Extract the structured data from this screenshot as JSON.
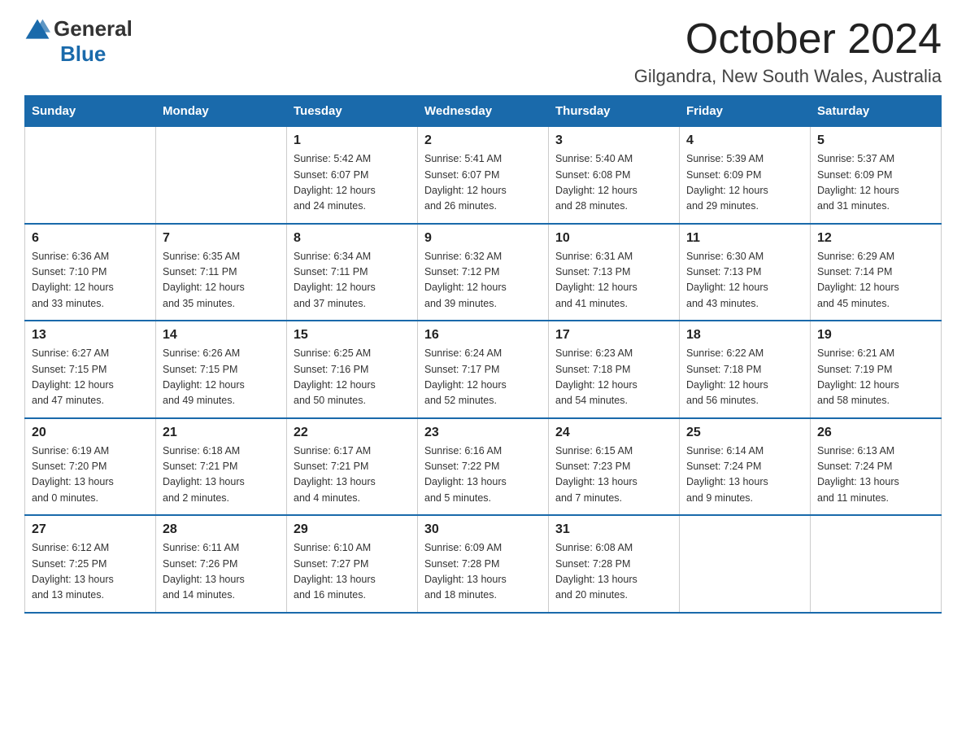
{
  "header": {
    "logo_general": "General",
    "logo_blue": "Blue",
    "month_year": "October 2024",
    "location": "Gilgandra, New South Wales, Australia"
  },
  "calendar": {
    "days_of_week": [
      "Sunday",
      "Monday",
      "Tuesday",
      "Wednesday",
      "Thursday",
      "Friday",
      "Saturday"
    ],
    "weeks": [
      [
        {
          "day": "",
          "info": ""
        },
        {
          "day": "",
          "info": ""
        },
        {
          "day": "1",
          "info": "Sunrise: 5:42 AM\nSunset: 6:07 PM\nDaylight: 12 hours\nand 24 minutes."
        },
        {
          "day": "2",
          "info": "Sunrise: 5:41 AM\nSunset: 6:07 PM\nDaylight: 12 hours\nand 26 minutes."
        },
        {
          "day": "3",
          "info": "Sunrise: 5:40 AM\nSunset: 6:08 PM\nDaylight: 12 hours\nand 28 minutes."
        },
        {
          "day": "4",
          "info": "Sunrise: 5:39 AM\nSunset: 6:09 PM\nDaylight: 12 hours\nand 29 minutes."
        },
        {
          "day": "5",
          "info": "Sunrise: 5:37 AM\nSunset: 6:09 PM\nDaylight: 12 hours\nand 31 minutes."
        }
      ],
      [
        {
          "day": "6",
          "info": "Sunrise: 6:36 AM\nSunset: 7:10 PM\nDaylight: 12 hours\nand 33 minutes."
        },
        {
          "day": "7",
          "info": "Sunrise: 6:35 AM\nSunset: 7:11 PM\nDaylight: 12 hours\nand 35 minutes."
        },
        {
          "day": "8",
          "info": "Sunrise: 6:34 AM\nSunset: 7:11 PM\nDaylight: 12 hours\nand 37 minutes."
        },
        {
          "day": "9",
          "info": "Sunrise: 6:32 AM\nSunset: 7:12 PM\nDaylight: 12 hours\nand 39 minutes."
        },
        {
          "day": "10",
          "info": "Sunrise: 6:31 AM\nSunset: 7:13 PM\nDaylight: 12 hours\nand 41 minutes."
        },
        {
          "day": "11",
          "info": "Sunrise: 6:30 AM\nSunset: 7:13 PM\nDaylight: 12 hours\nand 43 minutes."
        },
        {
          "day": "12",
          "info": "Sunrise: 6:29 AM\nSunset: 7:14 PM\nDaylight: 12 hours\nand 45 minutes."
        }
      ],
      [
        {
          "day": "13",
          "info": "Sunrise: 6:27 AM\nSunset: 7:15 PM\nDaylight: 12 hours\nand 47 minutes."
        },
        {
          "day": "14",
          "info": "Sunrise: 6:26 AM\nSunset: 7:15 PM\nDaylight: 12 hours\nand 49 minutes."
        },
        {
          "day": "15",
          "info": "Sunrise: 6:25 AM\nSunset: 7:16 PM\nDaylight: 12 hours\nand 50 minutes."
        },
        {
          "day": "16",
          "info": "Sunrise: 6:24 AM\nSunset: 7:17 PM\nDaylight: 12 hours\nand 52 minutes."
        },
        {
          "day": "17",
          "info": "Sunrise: 6:23 AM\nSunset: 7:18 PM\nDaylight: 12 hours\nand 54 minutes."
        },
        {
          "day": "18",
          "info": "Sunrise: 6:22 AM\nSunset: 7:18 PM\nDaylight: 12 hours\nand 56 minutes."
        },
        {
          "day": "19",
          "info": "Sunrise: 6:21 AM\nSunset: 7:19 PM\nDaylight: 12 hours\nand 58 minutes."
        }
      ],
      [
        {
          "day": "20",
          "info": "Sunrise: 6:19 AM\nSunset: 7:20 PM\nDaylight: 13 hours\nand 0 minutes."
        },
        {
          "day": "21",
          "info": "Sunrise: 6:18 AM\nSunset: 7:21 PM\nDaylight: 13 hours\nand 2 minutes."
        },
        {
          "day": "22",
          "info": "Sunrise: 6:17 AM\nSunset: 7:21 PM\nDaylight: 13 hours\nand 4 minutes."
        },
        {
          "day": "23",
          "info": "Sunrise: 6:16 AM\nSunset: 7:22 PM\nDaylight: 13 hours\nand 5 minutes."
        },
        {
          "day": "24",
          "info": "Sunrise: 6:15 AM\nSunset: 7:23 PM\nDaylight: 13 hours\nand 7 minutes."
        },
        {
          "day": "25",
          "info": "Sunrise: 6:14 AM\nSunset: 7:24 PM\nDaylight: 13 hours\nand 9 minutes."
        },
        {
          "day": "26",
          "info": "Sunrise: 6:13 AM\nSunset: 7:24 PM\nDaylight: 13 hours\nand 11 minutes."
        }
      ],
      [
        {
          "day": "27",
          "info": "Sunrise: 6:12 AM\nSunset: 7:25 PM\nDaylight: 13 hours\nand 13 minutes."
        },
        {
          "day": "28",
          "info": "Sunrise: 6:11 AM\nSunset: 7:26 PM\nDaylight: 13 hours\nand 14 minutes."
        },
        {
          "day": "29",
          "info": "Sunrise: 6:10 AM\nSunset: 7:27 PM\nDaylight: 13 hours\nand 16 minutes."
        },
        {
          "day": "30",
          "info": "Sunrise: 6:09 AM\nSunset: 7:28 PM\nDaylight: 13 hours\nand 18 minutes."
        },
        {
          "day": "31",
          "info": "Sunrise: 6:08 AM\nSunset: 7:28 PM\nDaylight: 13 hours\nand 20 minutes."
        },
        {
          "day": "",
          "info": ""
        },
        {
          "day": "",
          "info": ""
        }
      ]
    ]
  }
}
